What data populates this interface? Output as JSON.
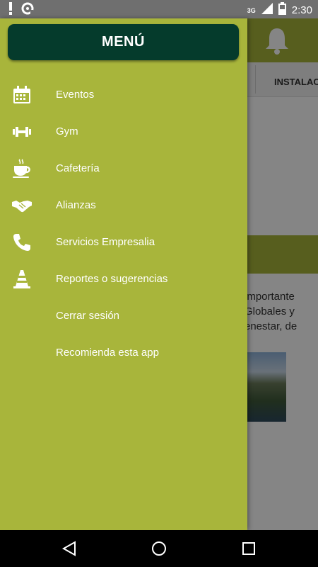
{
  "status_bar": {
    "time": "2:30",
    "network": "3G"
  },
  "background": {
    "tab_label": "INSTALAC",
    "text_lines": [
      "importante",
      "Globales y",
      "enestar, de"
    ]
  },
  "drawer": {
    "title": "MENÚ",
    "items": [
      {
        "label": "Eventos",
        "icon": "calendar-icon"
      },
      {
        "label": "Gym",
        "icon": "dumbbell-icon"
      },
      {
        "label": "Cafetería",
        "icon": "coffee-cup-icon"
      },
      {
        "label": "Alianzas",
        "icon": "handshake-icon"
      },
      {
        "label": "Servicios Empresalia",
        "icon": "phone-icon"
      },
      {
        "label": "Reportes o sugerencias",
        "icon": "traffic-cone-icon"
      },
      {
        "label": "Cerrar sesión",
        "icon": ""
      },
      {
        "label": "Recomienda esta app",
        "icon": ""
      }
    ]
  },
  "colors": {
    "drawer": "#a8b53b",
    "header": "#053b2c",
    "label": "#ffffff"
  }
}
